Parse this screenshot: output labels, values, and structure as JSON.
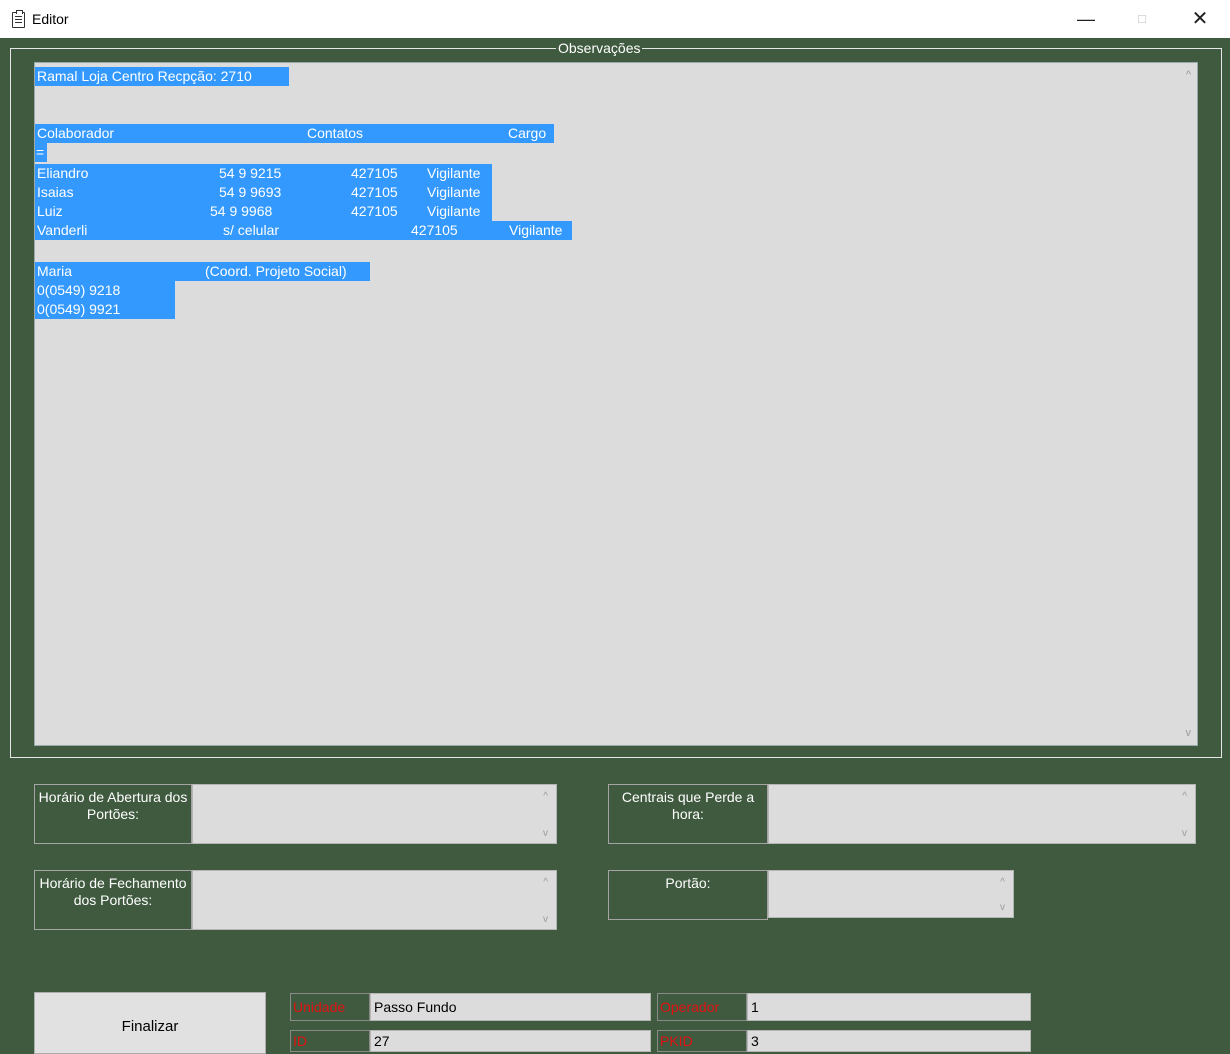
{
  "window": {
    "title": "Editor",
    "minimize": "—",
    "maximize": "□",
    "close": "✕"
  },
  "observacoes": {
    "legend": "Observações",
    "ramal": "Ramal Loja Centro Recpção: 2710",
    "header": {
      "colaborador": "Colaborador",
      "contatos": "Contatos",
      "cargo": "Cargo"
    },
    "separator": "=",
    "rows": [
      {
        "name": "Eliandro",
        "phone": "54 9 9215",
        "code": "427105",
        "role": "Vigilante"
      },
      {
        "name": "Isaias",
        "phone": "54 9 9693",
        "code": "427105",
        "role": "Vigilante"
      },
      {
        "name": "Luiz",
        "phone": "54 9 9968",
        "code": "427105",
        "role": "Vigilante"
      },
      {
        "name": "Vanderli",
        "phone": "s/ celular",
        "code": "427105",
        "role": "Vigilante"
      }
    ],
    "maria": {
      "name": "Maria",
      "role": "(Coord. Projeto Social)",
      "phone1": "0(0549) 9218",
      "phone2": "0(0549) 9921"
    }
  },
  "fields": {
    "abertura_label": "Horário de Abertura dos Portões:",
    "fechamento_label": "Horário de Fechamento dos Portões:",
    "centrais_label": "Centrais que Perde a hora:",
    "portao_label": "Portão:"
  },
  "footer": {
    "finalizar": "Finalizar",
    "unidade_label": "Unidade",
    "unidade_value": "Passo Fundo",
    "operador_label": "Operador",
    "operador_value": "1",
    "id_label": "ID",
    "id_value": "27",
    "pkid_label": "PKID",
    "pkid_value": "3"
  },
  "colors": {
    "background": "#3f5a3f",
    "selection": "#3399ff",
    "label_red": "#e01010"
  }
}
